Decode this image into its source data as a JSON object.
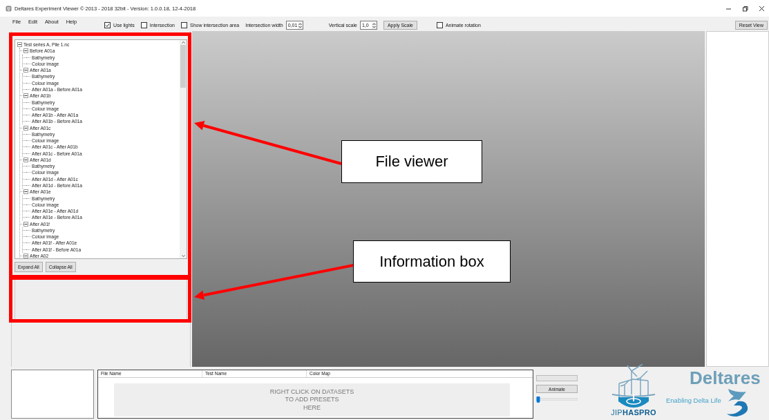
{
  "window": {
    "title": "Deltares Experiment Viewer © 2013 - 2018 32bit - Version: 1.0.0.18, 12-4-2018"
  },
  "menu": [
    "File",
    "Edit",
    "About",
    "Help"
  ],
  "toolbar": [
    {
      "kind": "checkbox",
      "label": "Use lights",
      "checked": true
    },
    {
      "kind": "checkbox",
      "label": "Intersection",
      "checked": false
    },
    {
      "kind": "checkbox",
      "label": "Show intersection area",
      "checked": false
    },
    {
      "kind": "spinner",
      "label": "Intersection width",
      "value": "0,01"
    },
    {
      "kind": "spinner",
      "label": "Vertical scale",
      "value": "1,0"
    },
    {
      "kind": "button",
      "label": "Apply Scale"
    },
    {
      "kind": "checkbox",
      "label": "Animate rotation",
      "checked": false
    },
    {
      "kind": "button",
      "label": "Reset View"
    }
  ],
  "file_tree": {
    "label": "Test series A, Pile 1.nc",
    "expanded": true,
    "children": [
      {
        "label": "Before A01a",
        "expanded": true,
        "children": [
          {
            "label": "Bathymetry"
          },
          {
            "label": "Colour image"
          }
        ]
      },
      {
        "label": "After A01a",
        "expanded": true,
        "children": [
          {
            "label": "Bathymetry"
          },
          {
            "label": "Colour image"
          },
          {
            "label": "After A01a - Before A01a"
          }
        ]
      },
      {
        "label": "After A01b",
        "expanded": true,
        "children": [
          {
            "label": "Bathymetry"
          },
          {
            "label": "Colour image"
          },
          {
            "label": "After A01b - After A01a"
          },
          {
            "label": "After A01b - Before A01a"
          }
        ]
      },
      {
        "label": "After A01c",
        "expanded": true,
        "children": [
          {
            "label": "Bathymetry"
          },
          {
            "label": "Colour image"
          },
          {
            "label": "After A01c - After A01b"
          },
          {
            "label": "After A01c - Before A01a"
          }
        ]
      },
      {
        "label": "After A01d",
        "expanded": true,
        "children": [
          {
            "label": "Bathymetry"
          },
          {
            "label": "Colour image"
          },
          {
            "label": "After A01d - After A01c"
          },
          {
            "label": "After A01d - Before A01a"
          }
        ]
      },
      {
        "label": "After A01e",
        "expanded": true,
        "children": [
          {
            "label": "Bathymetry"
          },
          {
            "label": "Colour image"
          },
          {
            "label": "After A01e - After A01d"
          },
          {
            "label": "After A01e - Before A01a"
          }
        ]
      },
      {
        "label": "After A01f",
        "expanded": true,
        "children": [
          {
            "label": "Bathymetry"
          },
          {
            "label": "Colour image"
          },
          {
            "label": "After A01f - After A01e"
          },
          {
            "label": "After A01f - Before A01a"
          }
        ]
      },
      {
        "label": "After A02",
        "expanded": true
      }
    ]
  },
  "tree_buttons": [
    "Expand All",
    "Collapse All"
  ],
  "presets": {
    "columns": [
      "File Name",
      "Test Name",
      "Color Map"
    ],
    "placeholder": [
      "RIGHT CLICK ON DATASETS",
      "TO ADD PRESETS",
      "HERE"
    ]
  },
  "animation": {
    "progress": {
      "level": 0
    },
    "button": "Animate",
    "slider": {
      "level": 0
    }
  },
  "branding": {
    "project": "JIP**HASPRO**",
    "company": "Deltares",
    "tagline": "Enabling Delta Life"
  },
  "annotations": [
    {
      "label": "File viewer"
    },
    {
      "label": "Information box"
    }
  ]
}
